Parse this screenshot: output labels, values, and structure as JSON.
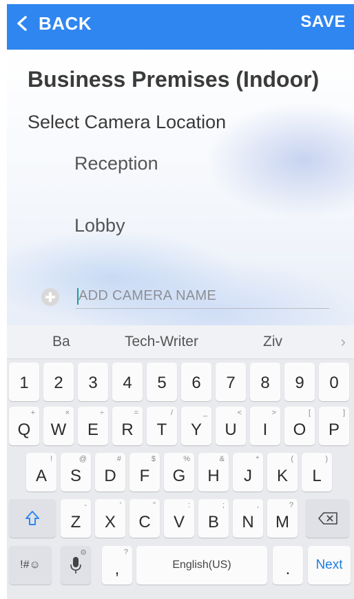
{
  "header": {
    "back_label": "BACK",
    "save_label": "SAVE",
    "color": "#2f86f0"
  },
  "main": {
    "title": "Business Premises (Indoor)",
    "subtitle": "Select Camera Location",
    "locations": [
      "Reception",
      "Lobby"
    ],
    "add_camera_placeholder": "ADD CAMERA NAME",
    "add_camera_value": ""
  },
  "keyboard": {
    "suggestions": [
      "Ba",
      "Tech-Writer",
      "Ziv"
    ],
    "numbers": [
      "1",
      "2",
      "3",
      "4",
      "5",
      "6",
      "7",
      "8",
      "9",
      "0"
    ],
    "row1": [
      {
        "k": "Q",
        "s": "+"
      },
      {
        "k": "W",
        "s": "×"
      },
      {
        "k": "E",
        "s": "÷"
      },
      {
        "k": "R",
        "s": "="
      },
      {
        "k": "T",
        "s": "/"
      },
      {
        "k": "Y",
        "s": "_"
      },
      {
        "k": "U",
        "s": "<"
      },
      {
        "k": "I",
        "s": ">"
      },
      {
        "k": "O",
        "s": "["
      },
      {
        "k": "P",
        "s": "]"
      }
    ],
    "row2": [
      {
        "k": "A",
        "s": "!"
      },
      {
        "k": "S",
        "s": "@"
      },
      {
        "k": "D",
        "s": "#"
      },
      {
        "k": "F",
        "s": "$"
      },
      {
        "k": "G",
        "s": "%"
      },
      {
        "k": "H",
        "s": "&"
      },
      {
        "k": "J",
        "s": "*"
      },
      {
        "k": "K",
        "s": "("
      },
      {
        "k": "L",
        "s": ")"
      }
    ],
    "row3": [
      {
        "k": "Z",
        "s": "-"
      },
      {
        "k": "X",
        "s": "'"
      },
      {
        "k": "C",
        "s": "\""
      },
      {
        "k": "V",
        "s": ":"
      },
      {
        "k": "B",
        "s": ";"
      },
      {
        "k": "N",
        "s": ","
      },
      {
        "k": "M",
        "s": "?"
      }
    ],
    "symbols_label": "!#☺",
    "comma_label": ",",
    "comma_sub": "?",
    "space_label": "English(US)",
    "period_label": ".",
    "next_label": "Next"
  }
}
